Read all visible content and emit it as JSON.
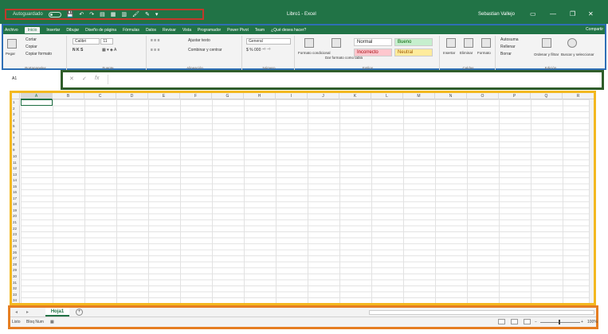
{
  "titlebar": {
    "autosave_label": "Autoguardado",
    "window_title": "Libro1 - Excel",
    "user_name": "Sebastian Vallejo",
    "minimize": "—",
    "restore": "❐",
    "close": "✕"
  },
  "ribbon": {
    "tabs": [
      "Archivo",
      "Inicio",
      "Insertar",
      "Dibujar",
      "Diseño de página",
      "Fórmulas",
      "Datos",
      "Revisar",
      "Vista",
      "Programador",
      "Power Pivot",
      "Team",
      "¿Qué desea hacer?"
    ],
    "active_tab": "Inicio",
    "share_label": "Compartir",
    "clipboard": {
      "name": "Portapapeles",
      "paste": "Pegar",
      "cut": "Cortar",
      "copy": "Copiar",
      "format_painter": "Copiar formato"
    },
    "font": {
      "name": "Fuente",
      "font_name": "Calibri",
      "font_size": "11"
    },
    "alignment": {
      "name": "Alineación",
      "wrap": "Ajustar texto",
      "merge": "Combinar y centrar"
    },
    "number": {
      "name": "Número",
      "format": "General"
    },
    "styles": {
      "name": "Estilos",
      "conditional": "Formato condicional",
      "as_table": "Dar formato como tabla",
      "normal": "Normal",
      "bueno": "Bueno",
      "incorrecto": "Incorrecto",
      "neutral": "Neutral"
    },
    "cells": {
      "name": "Celdas",
      "insert": "Insertar",
      "delete": "Eliminar",
      "format": "Formato"
    },
    "editing": {
      "name": "Edición",
      "autosum": "Autosuma",
      "fill": "Rellenar",
      "clear": "Borrar",
      "sort": "Ordenar y filtrar",
      "find": "Buscar y seleccionar"
    }
  },
  "formula_bar": {
    "name_box": "A1",
    "cancel": "✕",
    "enter": "✓",
    "fx": "fx",
    "value": ""
  },
  "sheet": {
    "columns": [
      "A",
      "B",
      "C",
      "D",
      "E",
      "F",
      "G",
      "H",
      "I",
      "J",
      "K",
      "L",
      "M",
      "N",
      "O",
      "P",
      "Q",
      "R"
    ],
    "rows": [
      "1",
      "2",
      "3",
      "4",
      "5",
      "6",
      "7",
      "8",
      "9",
      "10",
      "11",
      "12",
      "13",
      "14",
      "15",
      "16",
      "17",
      "18",
      "19",
      "20",
      "21",
      "22",
      "23",
      "24",
      "25",
      "26",
      "27",
      "28",
      "29",
      "30",
      "31",
      "32",
      "33",
      "34",
      "35"
    ],
    "active_cell": "A1"
  },
  "sheet_tabs": {
    "tabs": [
      "Hoja1"
    ],
    "add": "+"
  },
  "status": {
    "ready": "Listo",
    "num_lock": "Bloq Num",
    "zoom": "100%"
  }
}
